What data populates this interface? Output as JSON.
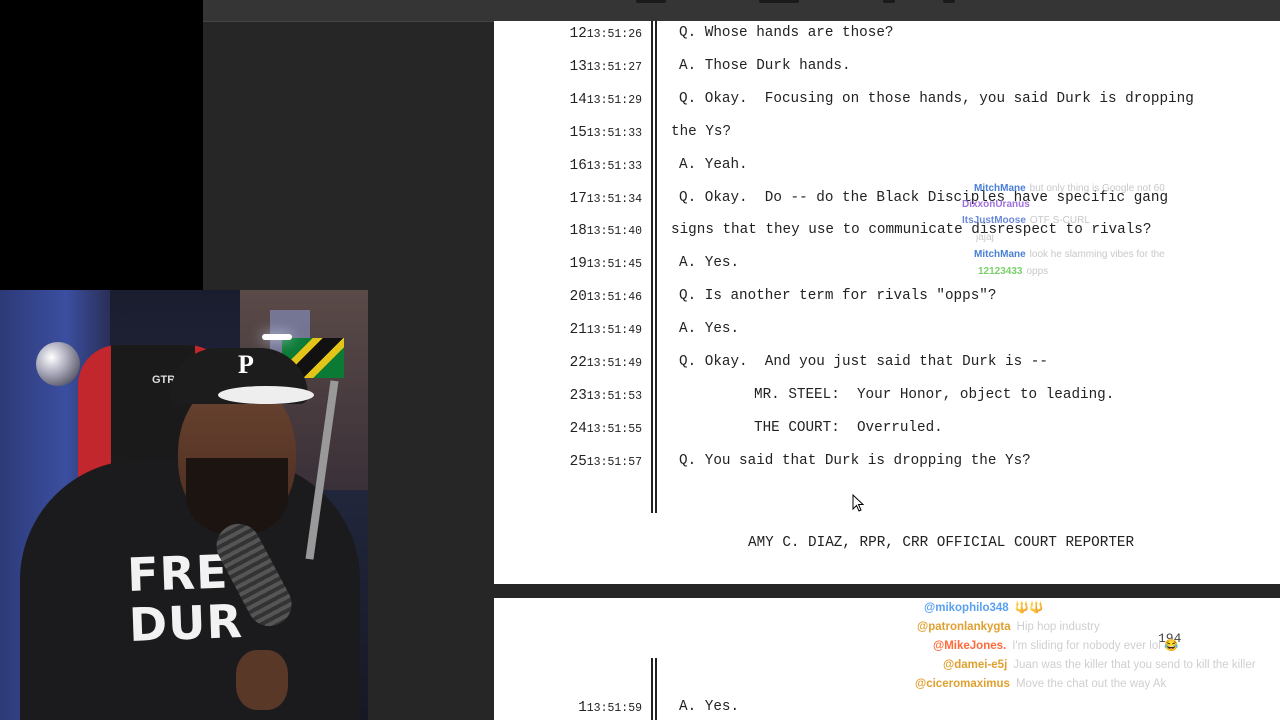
{
  "transcript": {
    "page1": {
      "lines": [
        {
          "num": "12",
          "time": "13:51:26",
          "text": "Q. Whose hands are those?"
        },
        {
          "num": "13",
          "time": "13:51:27",
          "text": "A. Those Durk hands."
        },
        {
          "num": "14",
          "time": "13:51:29",
          "text": "Q. Okay.  Focusing on those hands, you said Durk is dropping"
        },
        {
          "num": "15",
          "time": "13:51:33",
          "text": "the Ys?"
        },
        {
          "num": "16",
          "time": "13:51:33",
          "text": "A. Yeah."
        },
        {
          "num": "17",
          "time": "13:51:34",
          "text": "Q. Okay.  Do -- do the Black Disciples have specific gang"
        },
        {
          "num": "18",
          "time": "13:51:40",
          "text": "signs that they use to communicate disrespect to rivals?"
        },
        {
          "num": "19",
          "time": "13:51:45",
          "text": "A. Yes."
        },
        {
          "num": "20",
          "time": "13:51:46",
          "text": "Q. Is another term for rivals \"opps\"?"
        },
        {
          "num": "21",
          "time": "13:51:49",
          "text": "A. Yes."
        },
        {
          "num": "22",
          "time": "13:51:49",
          "text": "Q. Okay.  And you just said that Durk is --"
        },
        {
          "num": "23",
          "time": "13:51:53",
          "text": "MR. STEEL:  Your Honor, object to leading."
        },
        {
          "num": "24",
          "time": "13:51:55",
          "text": "THE COURT:  Overruled."
        },
        {
          "num": "25",
          "time": "13:51:57",
          "text": "Q. You said that Durk is dropping the Ys?"
        }
      ],
      "footer": "AMY C. DIAZ, RPR, CRR OFFICIAL COURT REPORTER"
    },
    "page2": {
      "page_number": "194",
      "lines": [
        {
          "num": "1",
          "time": "13:51:59",
          "text": "A. Yes."
        }
      ]
    }
  },
  "webcam": {
    "shirt_text": "FREE DURK",
    "shirt_line1": "FRE",
    "shirt_line2": "DUR",
    "cap_logo": "P",
    "chair_label": "GTR"
  },
  "chat_top": [
    {
      "user": "MitchMane",
      "msg": "but only thing is Google not 60",
      "color": "#4a7fd6"
    },
    {
      "user": "DixxonUranus",
      "msg": "",
      "color": "#a070e0"
    },
    {
      "user": "ItsJustMoose",
      "msg": "OTF S-CURL",
      "color": "#6a8ad8"
    },
    {
      "user": "",
      "msg": "jajaj",
      "color": "#b0b0b0"
    },
    {
      "user": "MitchMane",
      "msg": "look he slamming vibes for the",
      "color": "#4a7fd6"
    },
    {
      "user": "12123433",
      "msg": "opps",
      "color": "#7ad06a"
    }
  ],
  "chat_bottom": [
    {
      "user": "@mikophilo348",
      "msg": "🔱🔱",
      "color": "#5aa0f0"
    },
    {
      "user": "@patronlankygta",
      "msg": "Hip hop industry",
      "color": "#e0a030"
    },
    {
      "user": "@MikeJones.",
      "msg": "I'm sliding for nobody ever lol 😂",
      "color": "#ff6a3a"
    },
    {
      "user": "@damei-e5j",
      "msg": "Juan was the killer that you send to kill the killer",
      "color": "#e0a030"
    },
    {
      "user": "@ciceromaximus",
      "msg": "Move the chat out the way Ak",
      "color": "#e0a030"
    }
  ]
}
